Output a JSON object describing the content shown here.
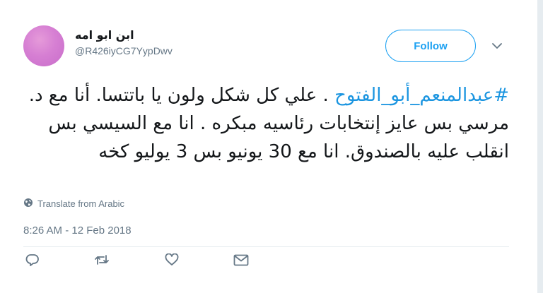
{
  "user": {
    "display_name": "ابن ابو امه",
    "handle": "@R426iyCG7YypDwv"
  },
  "follow": {
    "label": "Follow"
  },
  "tweet": {
    "hashtag": "#عبدالمنعم_أبو_الفتوح",
    "text": ". علي كل شكل ولون يا باتتسا. أنا مع د. مرسي بس عايز إنتخابات رئاسيه مبكره . انا مع السيسي بس انقلب عليه بالصندوق. انا مع 30 يونيو بس 3 يوليو كخه"
  },
  "translate": {
    "label": "Translate from Arabic"
  },
  "timestamp": "8:26 AM - 12 Feb 2018",
  "icons": {
    "reply": "reply-icon",
    "retweet": "retweet-icon",
    "like": "heart-icon",
    "dm": "envelope-icon",
    "caret": "chevron-down-icon",
    "globe": "globe-icon"
  },
  "colors": {
    "accent": "#1da1f2",
    "link": "#1b95e0",
    "muted": "#657786",
    "text": "#14171a"
  }
}
